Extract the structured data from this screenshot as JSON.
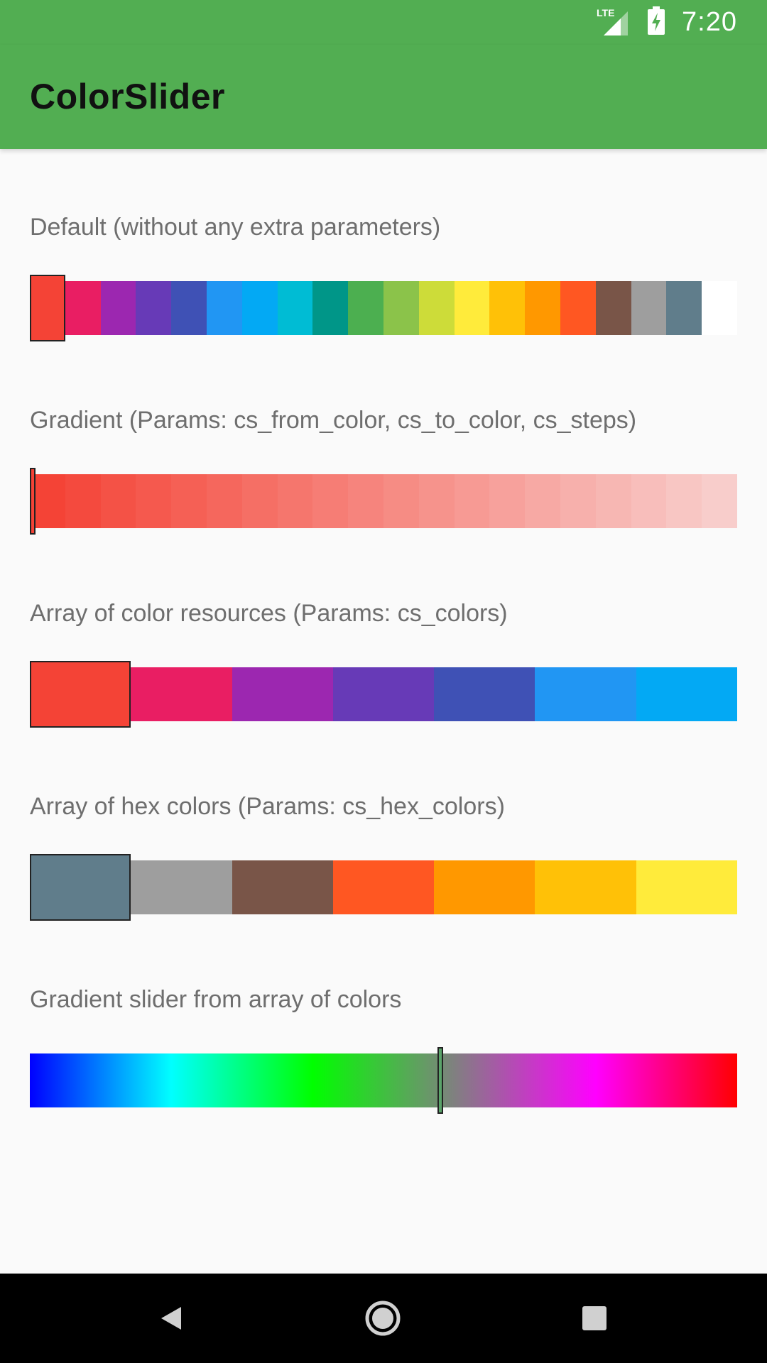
{
  "status_bar": {
    "time": "7:20",
    "network_label": "LTE",
    "icons": [
      "lte-signal-icon",
      "battery-charging-icon"
    ]
  },
  "app_bar": {
    "title": "ColorSlider",
    "background": "#52ae52"
  },
  "sliders": [
    {
      "label": "Default (without any extra parameters)",
      "type": "discrete",
      "colors": [
        "#f44336",
        "#e91e63",
        "#9c27b0",
        "#673ab7",
        "#3f51b5",
        "#2196f3",
        "#03a9f4",
        "#00bcd4",
        "#009688",
        "#4caf50",
        "#8bc34a",
        "#cddc39",
        "#ffeb3b",
        "#ffc107",
        "#ff9800",
        "#ff5722",
        "#795548",
        "#9e9e9e",
        "#607d8b",
        "#ffffff"
      ],
      "selected_index": 0
    },
    {
      "label": "Gradient (Params: cs_from_color, cs_to_color, cs_steps)",
      "type": "gradient-steps",
      "from_color": "#f44336",
      "to_color": "#f8cdcb",
      "selected_index": 0
    },
    {
      "label": "Array of color resources (Params: cs_colors)",
      "type": "discrete",
      "colors": [
        "#f44336",
        "#e91e63",
        "#9c27b0",
        "#673ab7",
        "#3f51b5",
        "#2196f3",
        "#03a9f4"
      ],
      "selected_index": 0
    },
    {
      "label": "Array of hex colors (Params: cs_hex_colors)",
      "type": "discrete",
      "colors": [
        "#607d8b",
        "#9e9e9e",
        "#795548",
        "#ff5722",
        "#ff9800",
        "#ffc107",
        "#ffeb3b"
      ],
      "selected_index": 0
    },
    {
      "label": "Gradient slider from array of colors",
      "type": "gradient",
      "colors": [
        "#0000ff",
        "#00ffff",
        "#00ff00",
        "#808080",
        "#ff00ff",
        "#ff0000"
      ],
      "thumb_position": 0.58,
      "thumb_color": "#5aa46a"
    }
  ],
  "nav_bar": {
    "buttons": [
      "back-icon",
      "home-icon",
      "recents-icon"
    ]
  }
}
